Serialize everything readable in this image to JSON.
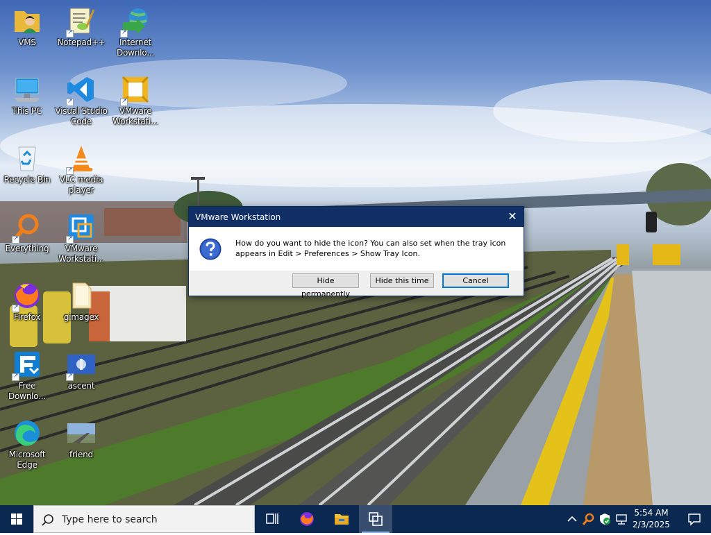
{
  "desktop": {
    "icons": [
      {
        "label": "VMS"
      },
      {
        "label": "Notepad++"
      },
      {
        "label": "Internet Downlo..."
      },
      {
        "label": "This PC"
      },
      {
        "label": "Visual Studio Code"
      },
      {
        "label": "VMware Workstati..."
      },
      {
        "label": "Recycle Bin"
      },
      {
        "label": "VLC media player"
      },
      {
        "label": "Everything"
      },
      {
        "label": "VMware Workstati..."
      },
      {
        "label": "Firefox"
      },
      {
        "label": "gimagex"
      },
      {
        "label": "Free Downlo..."
      },
      {
        "label": "ascent"
      },
      {
        "label": "Microsoft Edge"
      },
      {
        "label": "friend"
      }
    ]
  },
  "dialog": {
    "title": "VMware Workstation",
    "close_glyph": "✕",
    "message": "How do you want to hide the icon? You can also set when the tray icon appears in Edit > Preferences > Show Tray Icon.",
    "buttons": {
      "hide_permanently": "Hide permanently",
      "hide_this_time": "Hide this time",
      "cancel": "Cancel"
    },
    "icon": "question-icon"
  },
  "taskbar": {
    "search_placeholder": "Type here to search",
    "pinned": [
      "task-view-icon",
      "firefox-icon",
      "file-explorer-icon",
      "vmware-icon"
    ],
    "clock": {
      "time": "5:54 AM",
      "date": "2/3/2025"
    },
    "tray": [
      "chevron-up-icon",
      "everything-tray-icon",
      "security-icon",
      "network-icon",
      "notifications-icon"
    ]
  },
  "colors": {
    "taskbar": "#0b2850",
    "dialog_title": "#102f67",
    "default_button_border": "#0078d7"
  }
}
